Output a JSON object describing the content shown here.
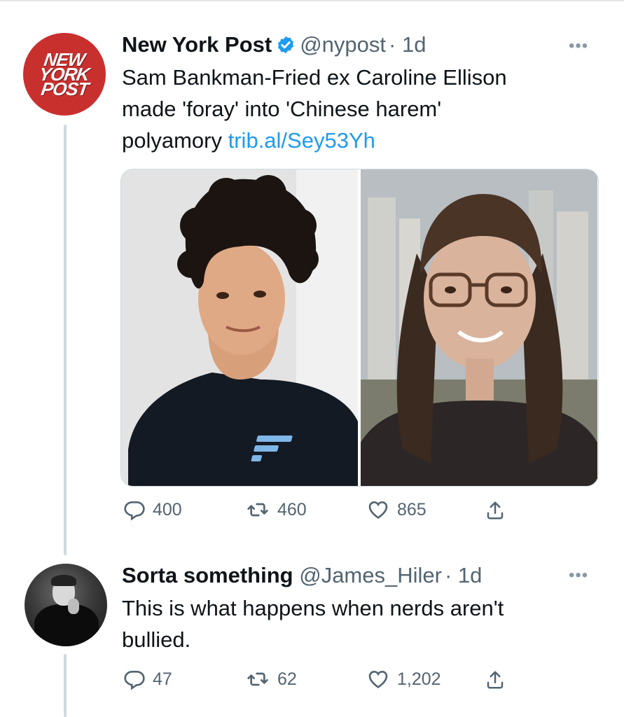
{
  "tweet": {
    "author": "New York Post",
    "handle": "@nypost",
    "time": "· 1d",
    "avatar_text": [
      "NEW",
      "YORK",
      "POST"
    ],
    "text_lines": [
      "Sam Bankman-Fried ex Caroline Ellison",
      "made 'foray' into 'Chinese harem'",
      "polyamory"
    ],
    "link": "trib.al/Sey53Yh",
    "more": "•••",
    "counts": {
      "replies": "400",
      "retweets": "460",
      "likes": "865"
    }
  },
  "reply": {
    "author": "Sorta something",
    "handle": "@James_Hiler",
    "time": "· 1d",
    "text_lines": [
      "This is what happens when nerds aren't",
      "bullied."
    ],
    "more": "•••",
    "counts": {
      "replies": "47",
      "retweets": "62",
      "likes": "1,202"
    }
  },
  "icons": {
    "verified": "verified-badge-icon",
    "reply": "reply-icon",
    "retweet": "retweet-icon",
    "like": "heart-icon",
    "share": "share-icon",
    "more": "more-icon"
  },
  "colors": {
    "link": "#1d9bf0",
    "verified": "#1d9bf0",
    "nypost_red": "#c8302e",
    "muted": "#536471",
    "thread_line": "#cfd9de"
  }
}
